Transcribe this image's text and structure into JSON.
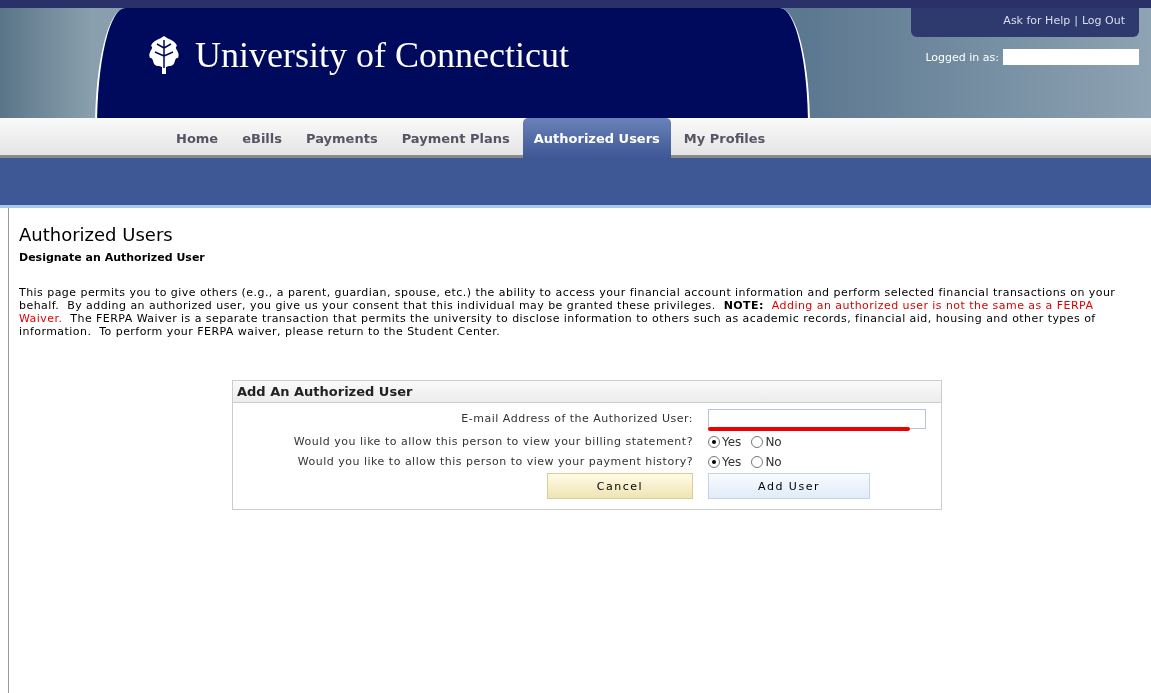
{
  "header": {
    "title": "University of Connecticut",
    "links": [
      {
        "label": "Ask for Help"
      },
      {
        "label": "Log Out"
      }
    ],
    "separator": "|",
    "logged_in_label": "Logged in as:"
  },
  "tabs": [
    {
      "label": "Home",
      "selected": false
    },
    {
      "label": "eBills",
      "selected": false
    },
    {
      "label": "Payments",
      "selected": false
    },
    {
      "label": "Payment Plans",
      "selected": false
    },
    {
      "label": "Authorized Users",
      "selected": true
    },
    {
      "label": "My Profiles",
      "selected": false
    }
  ],
  "page": {
    "title": "Authorized Users",
    "subtitle": "Designate an Authorized User",
    "intro": [
      {
        "kind": "plain",
        "text": "This page permits you to give others (e.g., a parent, guardian, spouse, etc.) the ability to access your financial account information and perform selected financial transactions on your behalf.  By adding an authorized user, you give us your consent that this individual may be granted these privileges.  "
      },
      {
        "kind": "bold",
        "text": "NOTE:"
      },
      {
        "kind": "warning",
        "text": "  Adding an authorized user is not the same as a FERPA Waiver."
      },
      {
        "kind": "plain",
        "text": "  The FERPA Waiver is a separate transaction that permits the university to disclose information to others such as academic records, financial aid, housing and other types of information.  To perform your FERPA waiver, please return to the Student Center."
      }
    ]
  },
  "form": {
    "title": "Add An Authorized User",
    "email_label": "E-mail Address of the Authorized User:",
    "questions": [
      {
        "label": "Would you like to allow this person to view your billing statement?",
        "options": [
          {
            "label": "Yes",
            "selected": true
          },
          {
            "label": "No",
            "selected": false
          }
        ]
      },
      {
        "label": "Would you like to allow this person to view your payment history?",
        "options": [
          {
            "label": "Yes",
            "selected": true
          },
          {
            "label": "No",
            "selected": false
          }
        ]
      }
    ],
    "buttons": [
      {
        "kind": "cancel",
        "label": "Cancel"
      },
      {
        "kind": "submit",
        "label": "Add User"
      }
    ]
  }
}
